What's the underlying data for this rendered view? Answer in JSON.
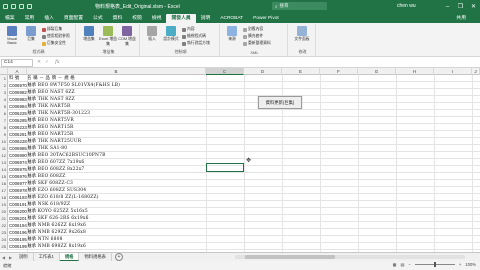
{
  "app": {
    "title": "物料規格表_Edit_Original.xlsm - Excel",
    "search_placeholder": "搜尋",
    "user": "chen wu",
    "window_controls": [
      "–",
      "❐",
      "✕"
    ],
    "accent_color": "#217346"
  },
  "ribbon": {
    "tabs": [
      "檔案",
      "常用",
      "插入",
      "頁面配置",
      "公式",
      "資料",
      "校閱",
      "檢視",
      "開發人員",
      "說明",
      "ACROBAT",
      "Power Pivot"
    ],
    "active_tab": "開發人員",
    "share_label": "共用",
    "groups": [
      {
        "label": "程式碼",
        "big": [
          "Visual Basic",
          "巨集"
        ],
        "small": [
          "錄製巨集",
          "使用相對參照",
          "巨集安全性"
        ]
      },
      {
        "label": "增益集",
        "big": [
          "增益集",
          "Excel 增益集",
          "COM 增益集"
        ]
      },
      {
        "label": "控制項",
        "big": [
          "插入",
          "設計模式"
        ],
        "small": [
          "內容",
          "檢視程式碼",
          "執行對話方塊"
        ]
      },
      {
        "label": "XML",
        "big": [
          "來源"
        ],
        "small": [
          "對應內容",
          "擴充套件",
          "重新整理資料"
        ]
      },
      {
        "label": "修改",
        "big": [
          "文件面板"
        ]
      }
    ]
  },
  "formula_bar": {
    "name_box": "C14",
    "fx_label": "fx",
    "formula": ""
  },
  "sheet": {
    "columns": [
      "A",
      "B",
      "C",
      "D",
      "E",
      "F",
      "G",
      "H",
      "I",
      "J",
      "K"
    ],
    "selected_column": "C",
    "header_row": {
      "a": "料 號",
      "b": "名 稱 － 品 牌 － 規 格"
    },
    "rows": [
      {
        "n": "2",
        "a": "C006970",
        "b": "軸承 BEO 8W7F50 SL01VX4(F&HS LB)"
      },
      {
        "n": "3",
        "a": "C006982",
        "b": "軸承 BEO NAST 6ZZ"
      },
      {
        "n": "4",
        "a": "C006983",
        "b": "軸承 THK NAST 8ZZ"
      },
      {
        "n": "5",
        "a": "C006984",
        "b": "軸承 THK NART5R"
      },
      {
        "n": "6",
        "a": "C006225",
        "b": "軸承 THK NART5R-301223"
      },
      {
        "n": "7",
        "a": "C006285",
        "b": "軸承 BEO NART5VR"
      },
      {
        "n": "8",
        "a": "C006223",
        "b": "軸承 BEO NART15R"
      },
      {
        "n": "9",
        "a": "C006281",
        "b": "軸承 BEO NART25R"
      },
      {
        "n": "10",
        "a": "C006228",
        "b": "軸承 THK NART25UUR"
      },
      {
        "n": "11",
        "a": "C006985",
        "b": "軸承 THK SA1-80"
      },
      {
        "n": "12",
        "a": "C006990",
        "b": "軸承 BEO 30TAC62BSUC10PN7B"
      },
      {
        "n": "13",
        "a": "C006974",
        "b": "軸承 BEO 607ZZ 7x19x6"
      },
      {
        "n": "14",
        "a": "C006975",
        "b": "軸承 BEO 608ZZ 8x22x7"
      },
      {
        "n": "15",
        "a": "C006976",
        "b": "軸承 BEO 608ZZ"
      },
      {
        "n": "16",
        "a": "C006977",
        "b": "軸承 SKF 608ZZ-C3"
      },
      {
        "n": "17",
        "a": "C006978",
        "b": "軸承 EZO 608ZZ SUS304"
      },
      {
        "n": "18",
        "a": "C006193",
        "b": "軸承 EZO 618/8 ZZ(L-1680ZZ)"
      },
      {
        "n": "19",
        "a": "C006191",
        "b": "軸承 NSK 618/9ZZ"
      },
      {
        "n": "20",
        "a": "C006200",
        "b": "軸承 KOYO 625ZZ 5x16x5"
      },
      {
        "n": "21",
        "a": "C006201",
        "b": "軸承 SKF 626-2RS 6x19x6"
      },
      {
        "n": "22",
        "a": "C006194",
        "b": "軸承 NMB 626ZZ 6x19x6"
      },
      {
        "n": "23",
        "a": "C006196",
        "b": "軸承 NMB 629ZZ 9x26x8"
      },
      {
        "n": "24",
        "a": "C006195",
        "b": "軸承 NTN 6808"
      },
      {
        "n": "25",
        "a": "C006199",
        "b": "軸承 NMB 698ZZ 8x19x6"
      }
    ]
  },
  "macro_button": {
    "label": "資料更新(巨集)"
  },
  "sheet_tabs": {
    "tabs": [
      "說明",
      "工作表1",
      "規格",
      "物料規格表"
    ],
    "active": "規格",
    "add_label": "+"
  },
  "status": {
    "left": "就緒",
    "zoom": "100%"
  }
}
